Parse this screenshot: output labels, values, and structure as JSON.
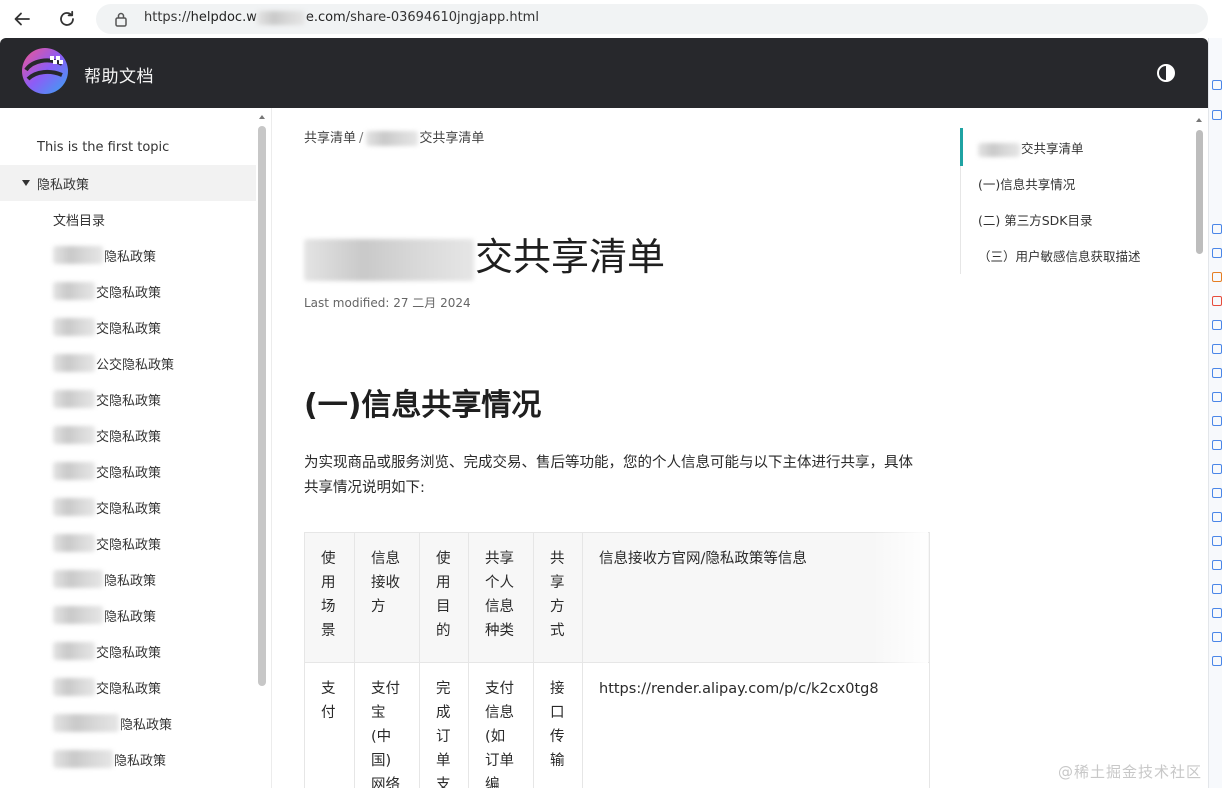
{
  "browser": {
    "url_prefix": "https://",
    "url_host": "helpdoc.w",
    "url_host_tail": "e.com",
    "url_path": "/share-03694610jngjapp.html"
  },
  "header": {
    "title": "帮助文档",
    "accent": "#27282c"
  },
  "leftnav": {
    "items": [
      {
        "label": "This is the first topic",
        "level": 1,
        "blur": 0
      },
      {
        "label": "隐私政策",
        "level": 1,
        "expanded": true,
        "selected": true,
        "blur": 0
      },
      {
        "label": "文档目录",
        "level": 2,
        "blur": 0
      },
      {
        "label": "隐私政策",
        "level": 2,
        "blur": 50
      },
      {
        "label": "交隐私政策",
        "level": 2,
        "blur": 40
      },
      {
        "label": "交隐私政策",
        "level": 2,
        "blur": 40
      },
      {
        "label": "公交隐私政策",
        "level": 2,
        "blur": 40
      },
      {
        "label": "交隐私政策",
        "level": 2,
        "blur": 40
      },
      {
        "label": "交隐私政策",
        "level": 2,
        "blur": 40
      },
      {
        "label": "交隐私政策",
        "level": 2,
        "blur": 40
      },
      {
        "label": "交隐私政策",
        "level": 2,
        "blur": 40
      },
      {
        "label": "交隐私政策",
        "level": 2,
        "blur": 40
      },
      {
        "label": "隐私政策",
        "level": 2,
        "blur": 50
      },
      {
        "label": "隐私政策",
        "level": 2,
        "blur": 50
      },
      {
        "label": "交隐私政策",
        "level": 2,
        "blur": 50
      },
      {
        "label": "交隐私政策",
        "level": 2,
        "blur": 50
      },
      {
        "label": "隐私政策",
        "level": 2,
        "blur": 70
      },
      {
        "label": "隐私政策",
        "level": 2,
        "blur": 62
      }
    ]
  },
  "main": {
    "breadcrumb": [
      "共享清单",
      "交共享清单"
    ],
    "breadcrumb_sep": "/",
    "title": "交共享清单",
    "last_modified": "Last modified: 27 二月 2024",
    "section_heading": "(一)信息共享情况",
    "paragraph": "为实现商品或服务浏览、完成交易、售后等功能，您的个人信息可能与以下主体进行共享，具体共享情况说明如下:",
    "table": {
      "headers": [
        "使用场景",
        "信息接收方",
        "使用目的",
        "共享个人信息种类",
        "共享方式",
        "信息接收方官网/隐私政策等信息"
      ],
      "rows": [
        [
          "支付",
          "支付宝(中国)网络",
          "完成订单支",
          "支付信息(如订单编",
          "接口传输",
          "https://render.alipay.com/p/c/k2cx0tg8"
        ]
      ]
    }
  },
  "toc": {
    "items": [
      "交共享清单",
      "(一)信息共享情况",
      "(二) 第三方SDK目录",
      "（三）用户敏感信息获取描述"
    ],
    "active_color": "#1fa3a3"
  },
  "watermark": "@稀土掘金技术社区"
}
